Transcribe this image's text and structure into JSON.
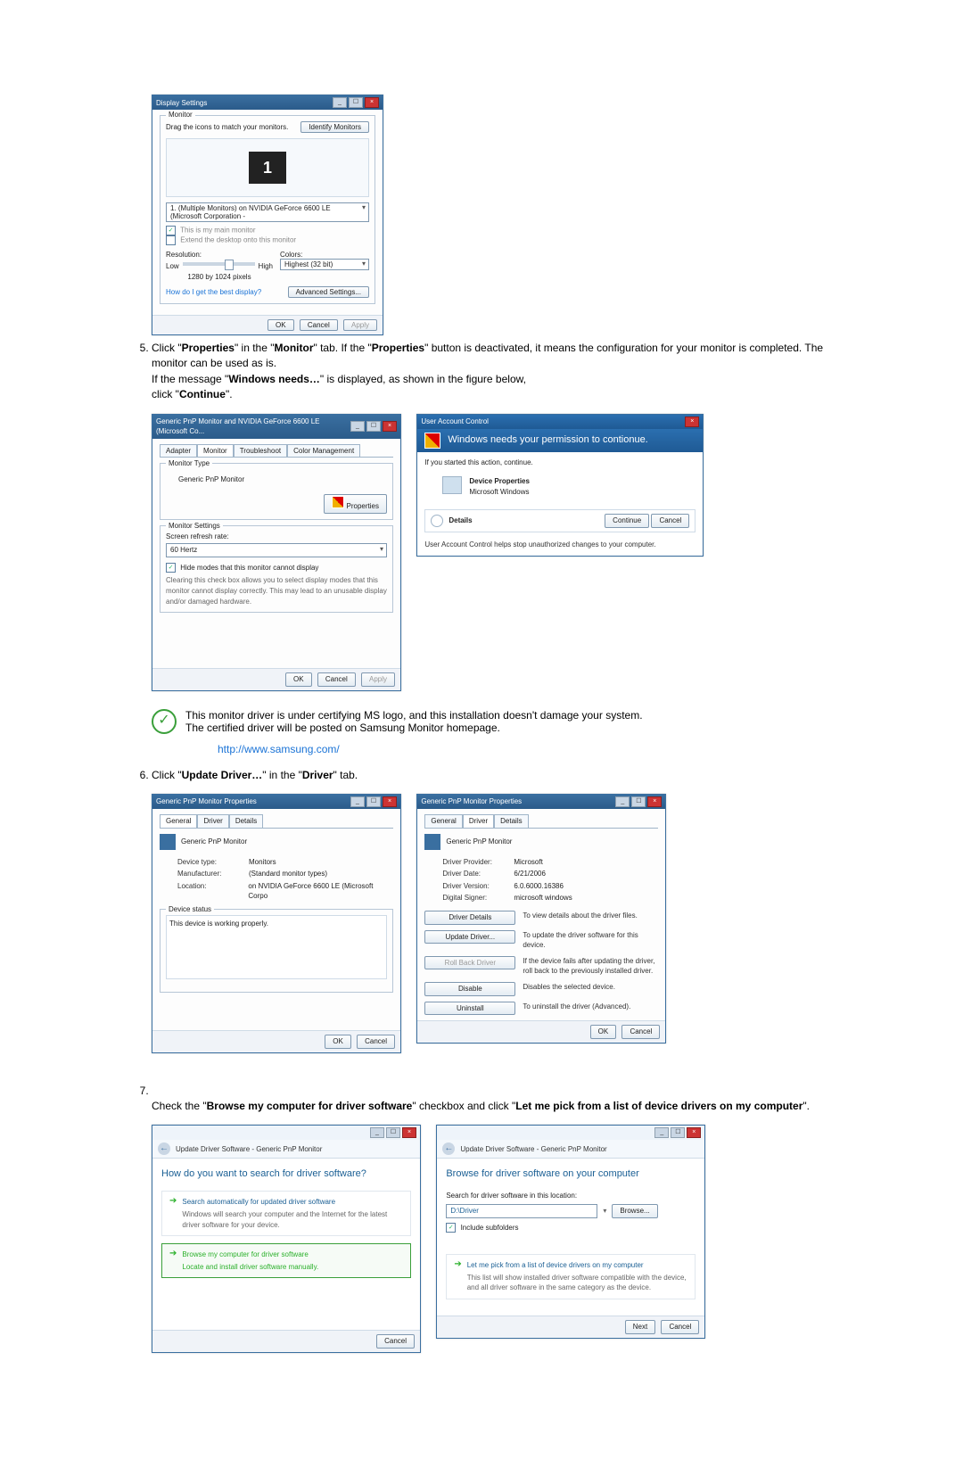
{
  "display_settings": {
    "title": "Display Settings",
    "tab_monitor": "Monitor",
    "drag_text": "Drag the icons to match your monitors.",
    "identify_btn": "Identify Monitors",
    "monitor_number": "1",
    "display_select": "1. (Multiple Monitors) on NVIDIA GeForce 6600 LE (Microsoft Corporation - ",
    "main_check": "This is my main monitor",
    "extend_check": "Extend the desktop onto this monitor",
    "resolution_label": "Resolution:",
    "low": "Low",
    "high": "High",
    "res_value": "1280 by 1024 pixels",
    "colors_label": "Colors:",
    "colors_value": "Highest (32 bit)",
    "help_link": "How do I get the best display?",
    "adv_btn": "Advanced Settings...",
    "ok": "OK",
    "cancel": "Cancel",
    "apply": "Apply"
  },
  "step5": {
    "line1_a": "Click \"",
    "properties": "Properties",
    "line1_b": "\" in the \"",
    "monitor": "Monitor",
    "line1_c": "\" tab. If the \"",
    "line1_d": "\" button is deactivated, it means the configuration for your monitor is completed. The monitor can be used as is.",
    "line2_a": "If the message \"",
    "winneeds": "Windows needs…",
    "line2_b": "\" is displayed, as shown in the figure below,",
    "line3_a": "click \"",
    "continue": "Continue",
    "line3_b": "\"."
  },
  "monitor_props": {
    "title": "Generic PnP Monitor and NVIDIA GeForce 6600 LE (Microsoft Co...",
    "tab_adapter": "Adapter",
    "tab_monitor": "Monitor",
    "tab_troubleshoot": "Troubleshoot",
    "tab_color": "Color Management",
    "type_legend": "Monitor Type",
    "type_value": "Generic PnP Monitor",
    "props_btn": "Properties",
    "settings_legend": "Monitor Settings",
    "refresh_label": "Screen refresh rate:",
    "refresh_value": "60 Hertz",
    "hide_check": "Hide modes that this monitor cannot display",
    "hide_desc": "Clearing this check box allows you to select display modes that this monitor cannot display correctly. This may lead to an unusable display and/or damaged hardware.",
    "ok": "OK",
    "cancel": "Cancel",
    "apply": "Apply"
  },
  "uac": {
    "title": "User Account Control",
    "banner": "Windows needs your permission to contionue.",
    "started_text": "If you started this action, continue.",
    "device_props": "Device Properties",
    "ms_win": "Microsoft Windows",
    "details": "Details",
    "continue": "Continue",
    "cancel": "Cancel",
    "footer": "User Account Control helps stop unauthorized changes to your computer."
  },
  "note": {
    "line1": "This monitor driver is under certifying MS logo, and this installation doesn't damage your system.",
    "line2": "The certified driver will be posted on Samsung Monitor homepage.",
    "url": "http://www.samsung.com/"
  },
  "step6": {
    "line_a": "Click \"",
    "update": "Update Driver…",
    "line_b": "\" in the \"",
    "driver": "Driver",
    "line_c": "\" tab."
  },
  "pnp_general": {
    "title": "Generic PnP Monitor Properties",
    "tab_general": "General",
    "tab_driver": "Driver",
    "tab_details": "Details",
    "header": "Generic PnP Monitor",
    "device_type_l": "Device type:",
    "device_type_v": "Monitors",
    "manufacturer_l": "Manufacturer:",
    "manufacturer_v": "(Standard monitor types)",
    "location_l": "Location:",
    "location_v": "on NVIDIA GeForce 6600 LE (Microsoft Corpo",
    "status_legend": "Device status",
    "status_text": "This device is working properly.",
    "ok": "OK",
    "cancel": "Cancel"
  },
  "pnp_driver": {
    "title": "Generic PnP Monitor Properties",
    "tab_general": "General",
    "tab_driver": "Driver",
    "tab_details": "Details",
    "header": "Generic PnP Monitor",
    "provider_l": "Driver Provider:",
    "provider_v": "Microsoft",
    "date_l": "Driver Date:",
    "date_v": "6/21/2006",
    "version_l": "Driver Version:",
    "version_v": "6.0.6000.16386",
    "signer_l": "Digital Signer:",
    "signer_v": "microsoft windows",
    "btn_details": "Driver Details",
    "btn_details_desc": "To view details about the driver files.",
    "btn_update": "Update Driver...",
    "btn_update_desc": "To update the driver software for this device.",
    "btn_rollback": "Roll Back Driver",
    "btn_rollback_desc": "If the device fails after updating the driver, roll back to the previously installed driver.",
    "btn_disable": "Disable",
    "btn_disable_desc": "Disables the selected device.",
    "btn_uninstall": "Uninstall",
    "btn_uninstall_desc": "To uninstall the driver (Advanced).",
    "ok": "OK",
    "cancel": "Cancel"
  },
  "step7": {
    "line_a": "Check the \"",
    "browse": "Browse my computer for driver software",
    "line_b": "\" checkbox and click \"",
    "letme": "Let me pick from a list of device drivers on my computer",
    "line_c": "\"."
  },
  "wiz_a": {
    "breadcrumb": "Update Driver Software - Generic PnP Monitor",
    "question": "How do you want to search for driver software?",
    "opt1_title": "Search automatically for updated driver software",
    "opt1_sub": "Windows will search your computer and the Internet for the latest driver software for your device.",
    "opt2_title": "Browse my computer for driver software",
    "opt2_sub": "Locate and install driver software manually.",
    "cancel": "Cancel"
  },
  "wiz_b": {
    "breadcrumb": "Update Driver Software - Generic PnP Monitor",
    "heading": "Browse for driver software on your computer",
    "search_label": "Search for driver software in this location:",
    "path_value": "D:\\Driver",
    "browse_btn": "Browse...",
    "include_check": "Include subfolders",
    "letme_title": "Let me pick from a list of device drivers on my computer",
    "letme_sub": "This list will show installed driver software compatible with the device, and all driver software in the same category as the device.",
    "next": "Next",
    "cancel": "Cancel"
  }
}
